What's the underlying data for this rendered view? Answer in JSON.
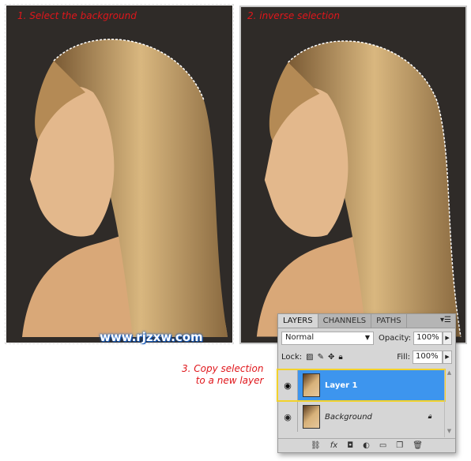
{
  "steps": {
    "step1": "1. Select the background",
    "step2": "2. inverse selection",
    "step3_line1": "3. Copy selection",
    "step3_line2": "to a new layer"
  },
  "watermark": "www.rjzxw.com",
  "layers_panel": {
    "tabs": [
      "LAYERS",
      "CHANNELS",
      "PATHS"
    ],
    "blend_mode": "Normal",
    "opacity_label": "Opacity:",
    "opacity": "100%",
    "lock_label": "Lock:",
    "fill_label": "Fill:",
    "fill": "100%",
    "layers": [
      {
        "name": "Layer 1",
        "selected": true
      },
      {
        "name": "Background",
        "locked": true
      }
    ]
  },
  "colors": {
    "step_text": "#e0161b",
    "selection": "#3d95ee",
    "highlight": "#f2d22b"
  }
}
